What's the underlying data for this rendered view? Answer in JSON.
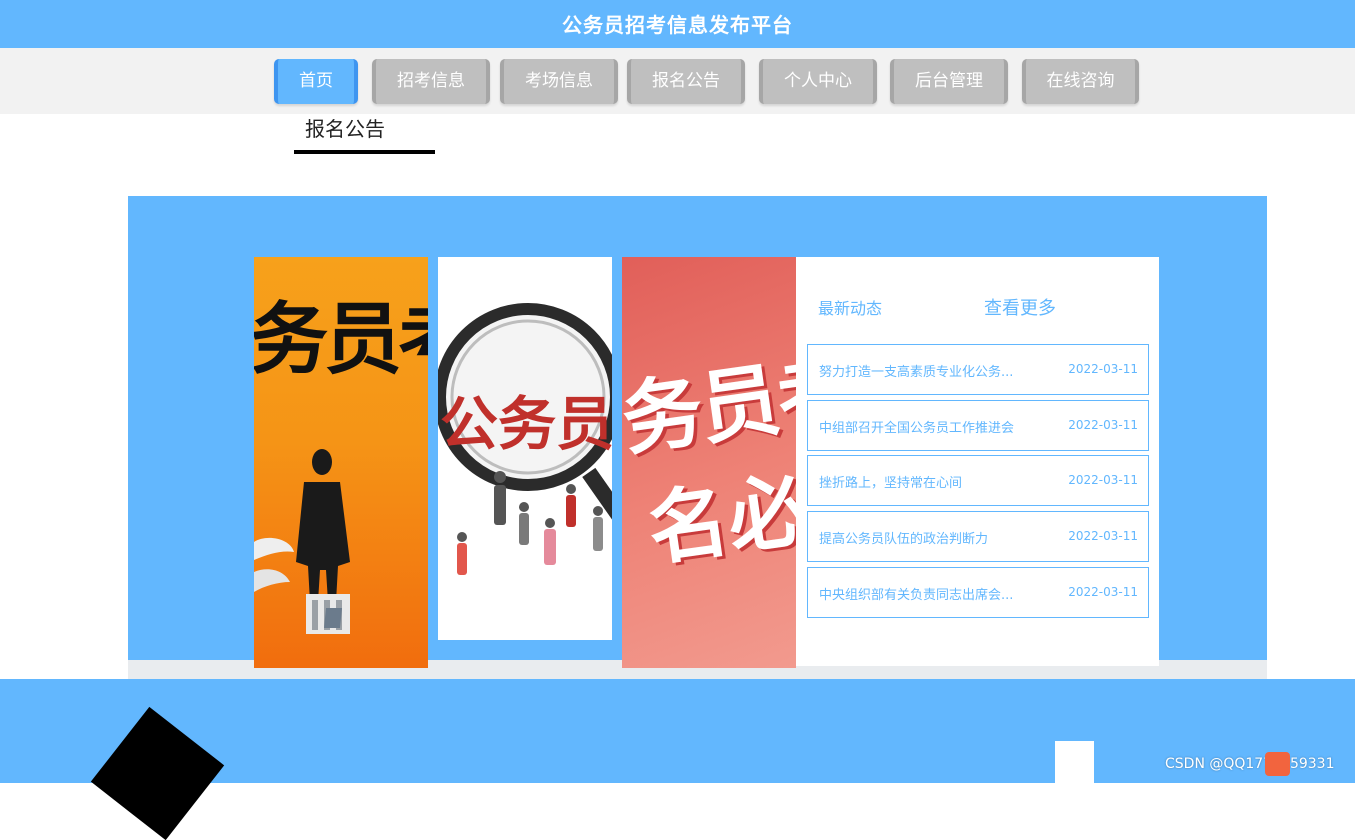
{
  "header": {
    "title": "公务员招考信息发布平台"
  },
  "nav": {
    "items": [
      {
        "label": "首页",
        "active": true
      },
      {
        "label": "招考信息",
        "active": false
      },
      {
        "label": "考场信息",
        "active": false
      },
      {
        "label": "报名公告",
        "active": false
      },
      {
        "label": "个人中心",
        "active": false
      },
      {
        "label": "后台管理",
        "active": false
      },
      {
        "label": "在线咨询",
        "active": false
      }
    ]
  },
  "section": {
    "title": "报名公告"
  },
  "banner": {
    "panels": [
      {
        "text": "务员考"
      },
      {
        "text": "公务员"
      },
      {
        "text_a": "务员考",
        "text_b": "名必"
      }
    ]
  },
  "news": {
    "heading": "最新动态",
    "more": "查看更多",
    "items": [
      {
        "title": "努力打造一支高素质专业化公务...",
        "date": "2022-03-11"
      },
      {
        "title": "中组部召开全国公务员工作推进会",
        "date": "2022-03-11"
      },
      {
        "title": "挫折路上，坚持常在心间",
        "date": "2022-03-11"
      },
      {
        "title": "提高公务员队伍的政治判断力",
        "date": "2022-03-11"
      },
      {
        "title": "中央组织部有关负责同志出席会...",
        "date": "2022-03-11"
      }
    ]
  },
  "footer": {
    "watermark": "CSDN @QQ1778259331"
  },
  "colors": {
    "primary": "#62b7fe",
    "nav_inactive": "#bfbfbf",
    "nav_bar": "#f2f2f2"
  }
}
